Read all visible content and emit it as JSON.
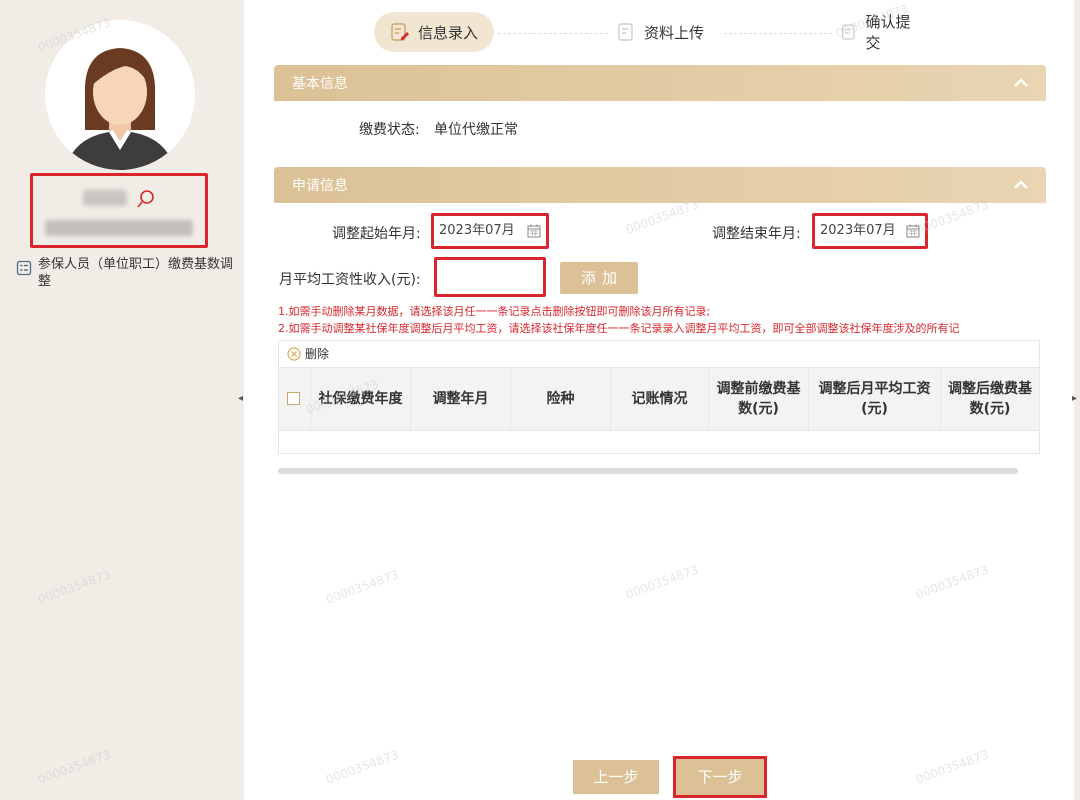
{
  "sidebar": {
    "menu_item_label": "参保人员（单位职工）缴费基数调整"
  },
  "steps": [
    {
      "label": "信息录入",
      "active": true
    },
    {
      "label": "资料上传",
      "active": false
    },
    {
      "label": "确认提交",
      "active": false
    }
  ],
  "basic_info": {
    "title": "基本信息",
    "status_label": "缴费状态:",
    "status_value": "单位代缴正常"
  },
  "apply_info": {
    "title": "申请信息",
    "start_label": "调整起始年月:",
    "start_value": "2023年07月",
    "end_label": "调整结束年月:",
    "end_value": "2023年07月",
    "income_label": "月平均工资性收入(元):",
    "income_value": "",
    "add_label": "添加"
  },
  "notes": [
    "1.如需手动删除某月数据，请选择该月任一一条记录点击删除按钮即可删除该月所有记录;",
    "2.如需手动调整某社保年度调整后月平均工资，请选择该社保年度任一一条记录录入调整月平均工资，即可全部调整该社保年度涉及的所有记"
  ],
  "table": {
    "delete_label": "删除",
    "columns": [
      "社保缴费年度",
      "调整年月",
      "险种",
      "记账情况",
      "调整前缴费基数(元)",
      "调整后月平均工资(元)",
      "调整后缴费基数(元)"
    ],
    "rows": []
  },
  "footer": {
    "prev_label": "上一步",
    "next_label": "下一步"
  },
  "watermark": "0000354873",
  "colors": {
    "accent": "#dcc196",
    "highlight": "#d9262c",
    "sidebar_bg": "#f1ece6"
  }
}
